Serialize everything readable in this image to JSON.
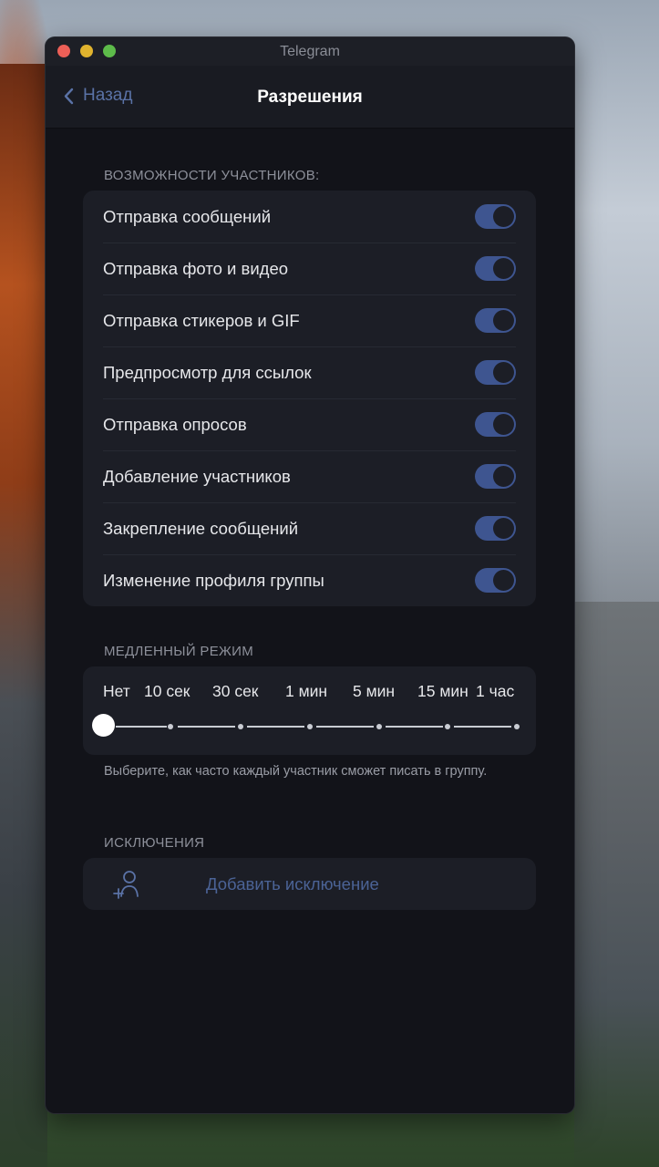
{
  "window": {
    "title": "Telegram"
  },
  "header": {
    "back_label": "Назад",
    "title": "Разрешения"
  },
  "permissions": {
    "section_title": "ВОЗМОЖНОСТИ УЧАСТНИКОВ:",
    "items": [
      {
        "label": "Отправка сообщений",
        "enabled": true
      },
      {
        "label": "Отправка фото и видео",
        "enabled": true
      },
      {
        "label": "Отправка стикеров и GIF",
        "enabled": true
      },
      {
        "label": "Предпросмотр для ссылок",
        "enabled": true
      },
      {
        "label": "Отправка опросов",
        "enabled": true
      },
      {
        "label": "Добавление участников",
        "enabled": true
      },
      {
        "label": "Закрепление сообщений",
        "enabled": true
      },
      {
        "label": "Изменение профиля группы",
        "enabled": true
      }
    ]
  },
  "slow_mode": {
    "section_title": "МЕДЛЕННЫЙ РЕЖИМ",
    "options": [
      "Нет",
      "10 сек",
      "30 сек",
      "1 мин",
      "5 мин",
      "15 мин",
      "1 час"
    ],
    "selected": "Нет",
    "hint": "Выберите, как часто каждый участник сможет писать в группу."
  },
  "exceptions": {
    "section_title": "ИСКЛЮЧЕНИЯ",
    "add_label": "Добавить исключение"
  },
  "colors": {
    "accent": "#3e5590",
    "link": "#5a72a6",
    "background": "#121319",
    "card": "#1c1e26"
  },
  "icons": {
    "back": "chevron-left-icon",
    "add_exception": "add-user-icon"
  }
}
